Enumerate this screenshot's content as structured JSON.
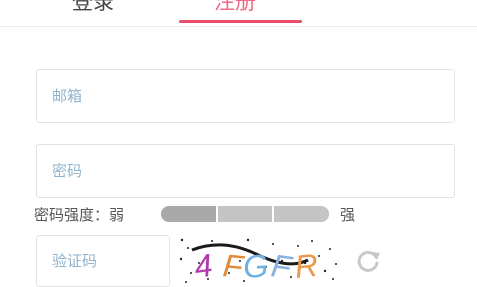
{
  "tabs": {
    "login_label": "登录",
    "register_label": "注册"
  },
  "form": {
    "email": {
      "placeholder": "邮箱",
      "value": ""
    },
    "password": {
      "placeholder": "密码",
      "value": ""
    },
    "strength": {
      "label": "密码强度：弱",
      "strong_label": "强",
      "segments": 3,
      "active_segments": 1
    },
    "captcha": {
      "placeholder": "验证码",
      "value": "",
      "image_text": "4FGFR"
    }
  },
  "icons": {
    "refresh": "refresh-icon"
  },
  "colors": {
    "accent": "#e94d6b",
    "placeholder": "#8fb3cc",
    "border": "#e3e3e3",
    "strength_bar": "#c4c4c4",
    "refresh_icon": "#c8c8c8"
  }
}
